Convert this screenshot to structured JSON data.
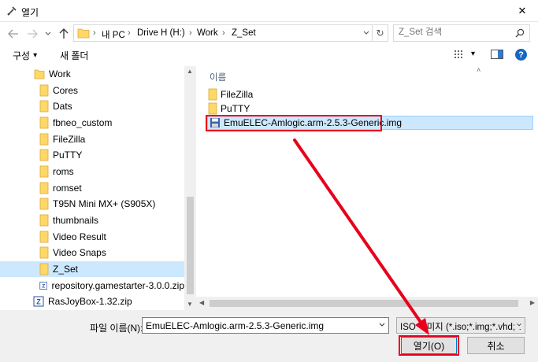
{
  "window": {
    "title": "열기",
    "close_glyph": "✕"
  },
  "address": {
    "crumbs": [
      "내 PC",
      "Drive H (H:)",
      "Work",
      "Z_Set"
    ],
    "separator": "›",
    "dropdown_glyph": "⌄",
    "refresh_glyph": "↻"
  },
  "search": {
    "placeholder": "Z_Set 검색"
  },
  "toolbar": {
    "organize_label": "구성",
    "organize_caret": "▾",
    "new_folder_label": "새 폴더",
    "view_caret": "▾",
    "help_glyph": "?"
  },
  "sidebar": {
    "items": [
      {
        "label": "Work",
        "icon": "folder-icon",
        "selected": false
      },
      {
        "label": "Cores",
        "icon": "folder-icon",
        "selected": false
      },
      {
        "label": "Dats",
        "icon": "folder-icon",
        "selected": false
      },
      {
        "label": "fbneo_custom",
        "icon": "folder-icon",
        "selected": false
      },
      {
        "label": "FileZilla",
        "icon": "folder-icon",
        "selected": false
      },
      {
        "label": "PuTTY",
        "icon": "folder-icon",
        "selected": false
      },
      {
        "label": "roms",
        "icon": "folder-icon",
        "selected": false
      },
      {
        "label": "romset",
        "icon": "folder-icon",
        "selected": false
      },
      {
        "label": "T95N Mini MX+ (S905X)",
        "icon": "folder-icon",
        "selected": false
      },
      {
        "label": "thumbnails",
        "icon": "folder-icon",
        "selected": false
      },
      {
        "label": "Video Result",
        "icon": "folder-icon",
        "selected": false
      },
      {
        "label": "Video Snaps",
        "icon": "folder-icon",
        "selected": false
      },
      {
        "label": "Z_Set",
        "icon": "folder-icon",
        "selected": true
      },
      {
        "label": "repository.gamestarter-3.0.0.zip",
        "icon": "zip-icon",
        "selected": false
      },
      {
        "label": "RasJoyBox-1.32.zip",
        "icon": "zip-icon",
        "selected": false
      }
    ]
  },
  "content": {
    "column_name": "이름",
    "files": [
      {
        "label": "FileZilla",
        "icon": "folder-icon",
        "selected": false
      },
      {
        "label": "PuTTY",
        "icon": "folder-icon",
        "selected": false
      },
      {
        "label": "EmuELEC-Amlogic.arm-2.5.3-Generic.img",
        "icon": "disk-image-icon",
        "selected": true
      }
    ]
  },
  "bottom": {
    "filename_label": "파일 이름(N):",
    "filename_value": "EmuELEC-Amlogic.arm-2.5.3-Generic.img",
    "filter_value": "ISO 이미지 (*.iso;*.img;*.vhd;*.",
    "open_label": "열기(O)",
    "cancel_label": "취소"
  },
  "colors": {
    "highlight_red": "#e8001c",
    "selection_blue": "#cce8ff",
    "folder_yellow": "#ffd867"
  }
}
